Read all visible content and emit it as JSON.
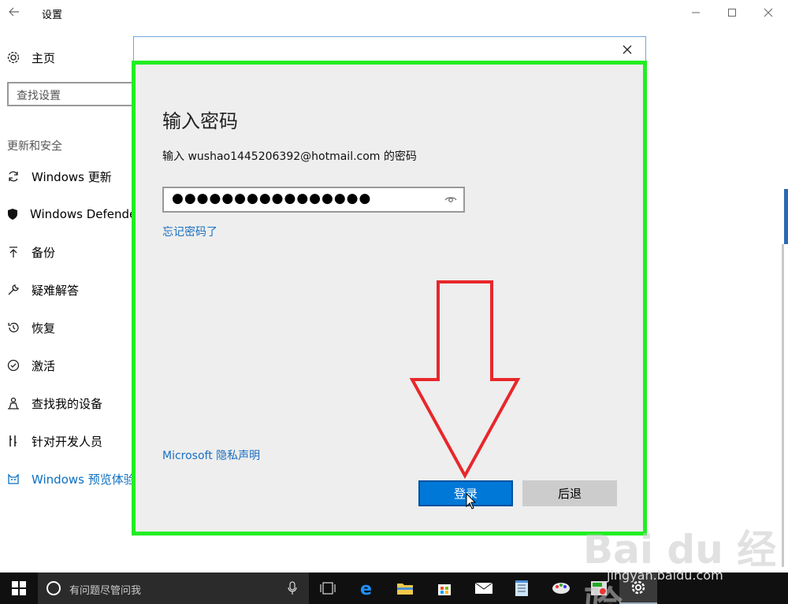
{
  "window": {
    "title": "设置"
  },
  "sidebar": {
    "home_label": "主页",
    "search_placeholder": "查找设置",
    "section_title": "更新和安全",
    "items": [
      {
        "label": "Windows 更新",
        "icon": "sync-icon"
      },
      {
        "label": "Windows Defender",
        "icon": "shield-icon"
      },
      {
        "label": "备份",
        "icon": "backup-icon"
      },
      {
        "label": "疑难解答",
        "icon": "wrench-icon"
      },
      {
        "label": "恢复",
        "icon": "history-icon"
      },
      {
        "label": "激活",
        "icon": "check-circle-icon"
      },
      {
        "label": "查找我的设备",
        "icon": "person-locate-icon"
      },
      {
        "label": "针对开发人员",
        "icon": "developer-icon"
      },
      {
        "label": "Windows 预览体验",
        "icon": "cat-icon"
      }
    ]
  },
  "dialog": {
    "title": "输入密码",
    "prompt": "输入 wushao1445206392@hotmail.com 的密码",
    "password_mask": "●●●●●●●●●●●●●●●●",
    "forgot_link": "忘记密码了",
    "privacy_link": "Microsoft 隐私声明",
    "login_button": "登录",
    "back_button": "后退"
  },
  "taskbar": {
    "search_text": "有问题尽管问我",
    "apps": [
      "task-view-icon",
      "edge-icon",
      "file-explorer-icon",
      "store-icon",
      "mail-icon",
      "notepad-icon",
      "paint-icon",
      "calculator-icon",
      "settings-icon"
    ]
  },
  "watermark": {
    "text": "Bai du 经验",
    "url": "jingyan.baidu.com"
  },
  "colors": {
    "accent": "#0078d7",
    "highlight": "#22ee22",
    "arrow": "#e8272b"
  }
}
